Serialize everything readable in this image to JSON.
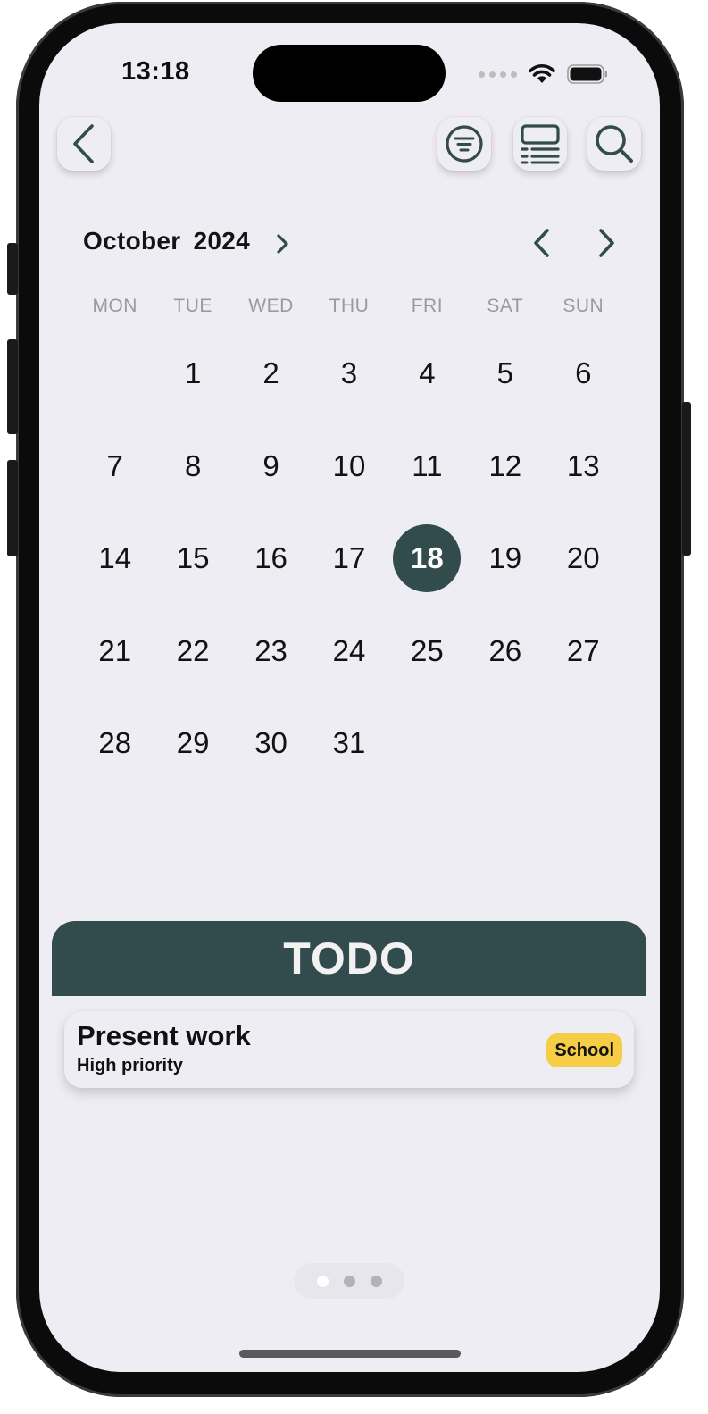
{
  "status_bar": {
    "time": "13:18"
  },
  "calendar": {
    "month": "October",
    "year": "2024",
    "weekdays": [
      "MON",
      "TUE",
      "WED",
      "THU",
      "FRI",
      "SAT",
      "SUN"
    ],
    "weeks": [
      [
        "",
        "1",
        "2",
        "3",
        "4",
        "5",
        "6"
      ],
      [
        "7",
        "8",
        "9",
        "10",
        "11",
        "12",
        "13"
      ],
      [
        "14",
        "15",
        "16",
        "17",
        "18",
        "19",
        "20"
      ],
      [
        "21",
        "22",
        "23",
        "24",
        "25",
        "26",
        "27"
      ],
      [
        "28",
        "29",
        "30",
        "31",
        "",
        "",
        ""
      ]
    ],
    "selected_day": "18"
  },
  "todo": {
    "header": "TODO",
    "tasks": [
      {
        "title": "Present work",
        "priority": "High priority",
        "tag": "School"
      }
    ]
  },
  "pager": {
    "pages": 3,
    "active_page": 1
  },
  "colors": {
    "accent": "#324b4c",
    "background": "#eeedf3",
    "tag": "#f6ce46"
  },
  "icons": {
    "back": "chevron-left-icon",
    "filter": "filter-icon",
    "layout": "list-layout-icon",
    "search": "search-icon"
  }
}
